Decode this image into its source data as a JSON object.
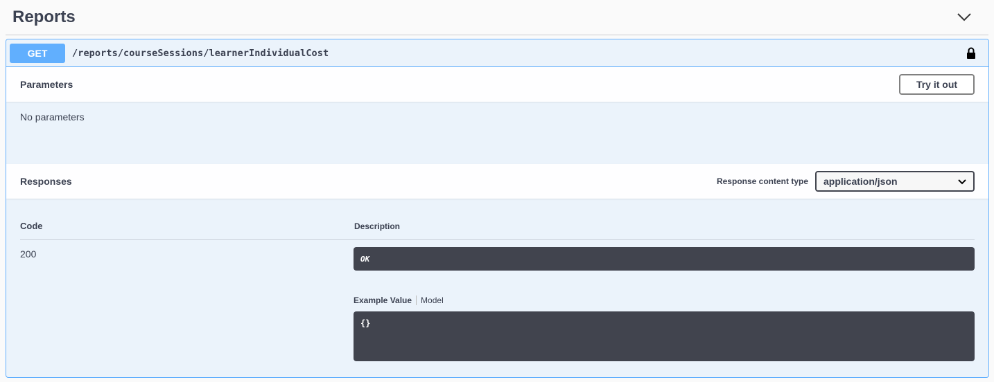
{
  "tag": {
    "title": "Reports"
  },
  "operation": {
    "method": "GET",
    "path": "/reports/courseSessions/learnerIndividualCost"
  },
  "parameters": {
    "title": "Parameters",
    "try_label": "Try it out",
    "empty_text": "No parameters"
  },
  "responses": {
    "title": "Responses",
    "content_type_label": "Response content type",
    "content_type_value": "application/json",
    "col_code": "Code",
    "col_description": "Description",
    "rows": [
      {
        "code": "200",
        "description": "OK",
        "example_tab": "Example Value",
        "model_tab": "Model",
        "example_value": "{}"
      }
    ]
  },
  "colors": {
    "accent": "#61affe",
    "panel": "#ebf3fb",
    "dark": "#41444e"
  },
  "icons": {
    "collapse": "chevron-down-icon",
    "lock": "lock-icon",
    "select": "chevron-down-icon"
  }
}
